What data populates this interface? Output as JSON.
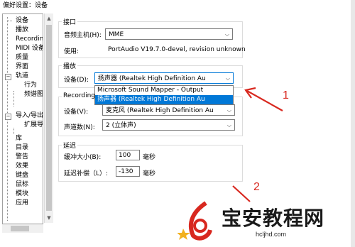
{
  "window": {
    "title": "偏好设置：设备"
  },
  "sidebar": {
    "items": [
      {
        "label": "设备",
        "indent": 0
      },
      {
        "label": "播放",
        "indent": 0
      },
      {
        "label": "Recording",
        "indent": 0
      },
      {
        "label": "MIDI 设备",
        "indent": 0
      },
      {
        "label": "质量",
        "indent": 0
      },
      {
        "label": "界面",
        "indent": 0
      },
      {
        "label": "轨道",
        "indent": 0
      },
      {
        "label": "行为",
        "indent": 2
      },
      {
        "label": "频谱图",
        "indent": 2
      },
      {
        "label": "导入/导出",
        "indent": 0
      },
      {
        "label": "扩展导",
        "indent": 2
      },
      {
        "label": "库",
        "indent": 0
      },
      {
        "label": "目录",
        "indent": 0
      },
      {
        "label": "警告",
        "indent": 0
      },
      {
        "label": "效果",
        "indent": 0
      },
      {
        "label": "键盘",
        "indent": 0
      },
      {
        "label": "鼠标",
        "indent": 0
      },
      {
        "label": "模块",
        "indent": 0
      },
      {
        "label": "应用",
        "indent": 0
      }
    ]
  },
  "interface": {
    "title": "接口",
    "host_label": "音频主机(H):",
    "host_value": "MME",
    "using_label": "使用:",
    "using_value": "PortAudio V19.7.0-devel, revision unknown"
  },
  "playback": {
    "title": "播放",
    "device_label": "设备(D):",
    "device_value": "扬声器 (Realtek High Definition Au",
    "dropdown_options": [
      "Microsoft Sound Mapper - Output",
      "扬声器 (Realtek High Definition Au"
    ]
  },
  "recording": {
    "title": "Recording",
    "device_label": "设备(V):",
    "device_value": "麦克风 (Realtek High Definition Au",
    "channels_label": "声道数(N):",
    "channels_value": "2 (立体声)"
  },
  "latency": {
    "title": "延迟",
    "buffer_label": "缓冲大小(B):",
    "buffer_value": "100",
    "buffer_unit": "毫秒",
    "comp_label": "延迟补偿（L）:",
    "comp_value": "-130",
    "comp_unit": "毫秒"
  },
  "annotations": {
    "one": "1",
    "two": "2"
  },
  "watermark": {
    "text": "宝安教程网",
    "url": "hcljhd.com"
  },
  "colors": {
    "accent": "#0078d7",
    "annotation": "#d8281f"
  }
}
